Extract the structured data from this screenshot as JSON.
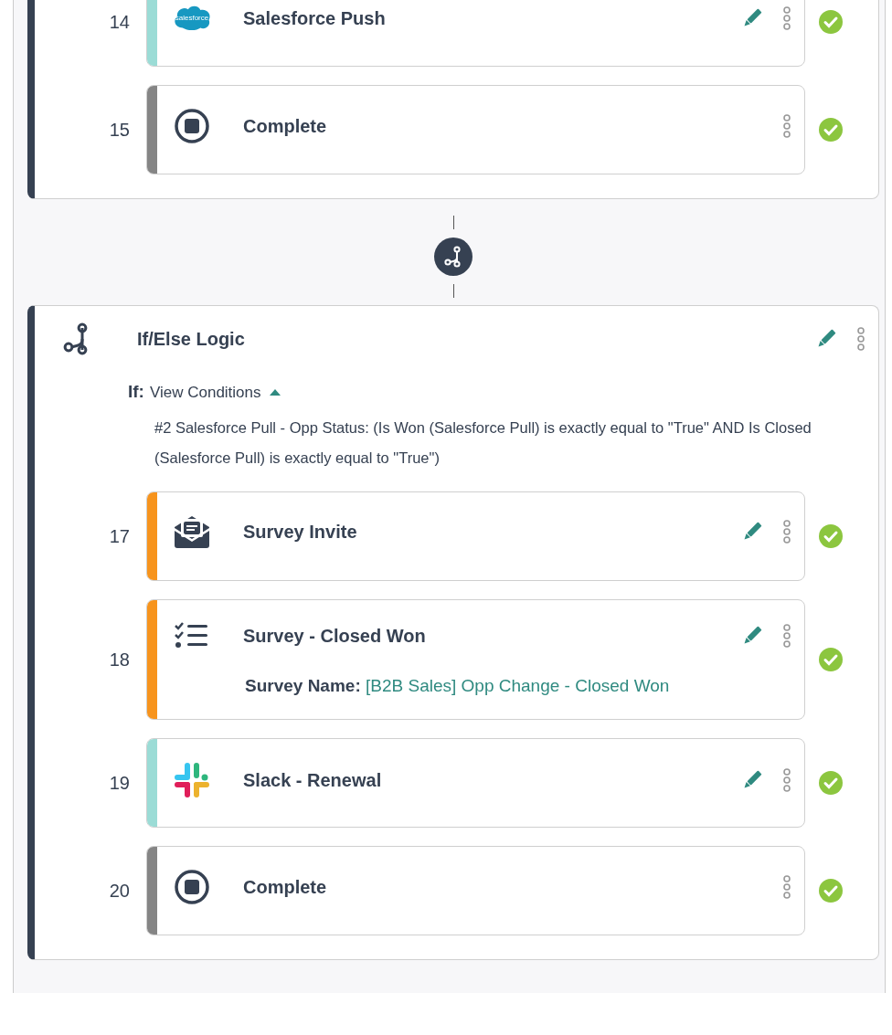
{
  "groups": [
    {
      "steps": [
        {
          "number": "14",
          "kind": "salesforce",
          "logo_text": "salesforce",
          "title": "Salesforce Push",
          "color": "#9bdcd6",
          "editable": true,
          "complete": true
        },
        {
          "number": "15",
          "kind": "stop",
          "title": "Complete",
          "color": "#858585",
          "editable": false,
          "complete": true
        }
      ]
    },
    {
      "header": {
        "title": "If/Else Logic",
        "editable": true
      },
      "condition": {
        "label": "If:",
        "toggle": "View Conditions",
        "expanded": true,
        "text": "#2 Salesforce Pull - Opp Status: (Is Won (Salesforce Pull) is exactly equal to \"True\" AND Is Closed (Salesforce Pull) is exactly equal to \"True\")"
      },
      "steps": [
        {
          "number": "17",
          "kind": "survey-invite",
          "title": "Survey Invite",
          "color": "#f7941d",
          "editable": true,
          "complete": true
        },
        {
          "number": "18",
          "kind": "checklist",
          "title": "Survey - Closed Won",
          "color": "#f7941d",
          "editable": true,
          "complete": true,
          "detail": {
            "label": "Survey Name:",
            "value": "[B2B Sales] Opp Change - Closed Won"
          }
        },
        {
          "number": "19",
          "kind": "slack",
          "title": "Slack - Renewal",
          "color": "#9bdcd6",
          "editable": true,
          "complete": true
        },
        {
          "number": "20",
          "kind": "stop",
          "title": "Complete",
          "color": "#858585",
          "editable": false,
          "complete": true
        }
      ]
    }
  ]
}
